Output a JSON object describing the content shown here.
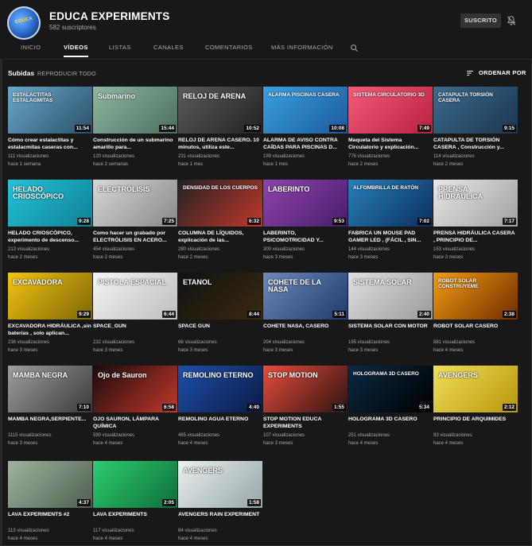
{
  "channel": {
    "name": "EDUCA EXPERIMENTS",
    "subscribers": "582 suscriptores",
    "subscribed_label": "SUSCRITO",
    "avatar_text": "EDUCA"
  },
  "tabs": [
    {
      "label": "INICIO",
      "active": false
    },
    {
      "label": "VÍDEOS",
      "active": true
    },
    {
      "label": "LISTAS",
      "active": false
    },
    {
      "label": "CANALES",
      "active": false
    },
    {
      "label": "COMENTARIOS",
      "active": false
    },
    {
      "label": "MÁS INFORMACIÓN",
      "active": false
    }
  ],
  "section": {
    "title": "Subidas",
    "play_all": "REPRODUCIR TODO",
    "sort_label": "ORDENAR POR"
  },
  "videos": [
    {
      "title": "Cómo crear estalactitas y estalacmitas caseras con...",
      "views": "111 visualizaciones",
      "age": "hace 1 semana",
      "duration": "11:54",
      "thumb_text": "ESTALACTITAS · ESTALAGMITAS",
      "colors": [
        "#6aa9c9",
        "#2b4f6a"
      ]
    },
    {
      "title": "Construcción de un submarino amarillo para...",
      "views": "120 visualizaciones",
      "age": "hace 2 semanas",
      "duration": "15:44",
      "thumb_text": "Submarino",
      "colors": [
        "#8db7a0",
        "#4d6e5e"
      ]
    },
    {
      "title": "RELOJ DE ARENA CASERO. 10 minutos, utiliza este...",
      "views": "231 visualizaciones",
      "age": "hace 1 mes",
      "duration": "10:52",
      "thumb_text": "RELOJ DE ARENA",
      "colors": [
        "#5b5b5b",
        "#222222"
      ]
    },
    {
      "title": "ALARMA DE AVISO CONTRA CAÍDAS PARA PISCINAS D...",
      "views": "199 visualizaciones",
      "age": "hace 1 mes",
      "duration": "10:08",
      "thumb_text": "ALARMA PISCINAS CASERA",
      "colors": [
        "#3aa0e0",
        "#1c5a9a"
      ]
    },
    {
      "title": "Maqueta del Sistema Circulatorio y explicación...",
      "views": "776 visualizaciones",
      "age": "hace 2 meses",
      "duration": "7:49",
      "thumb_text": "SISTEMA CIRCULATORIO 3D",
      "colors": [
        "#f25c7a",
        "#b8203e"
      ]
    },
    {
      "title": "CATAPULTA DE TORSIÓN CASERA , Construcción y...",
      "views": "114 visualizaciones",
      "age": "hace 2 meses",
      "duration": "9:15",
      "thumb_text": "CATAPULTA TORSIÓN CASERA",
      "colors": [
        "#3b6b8e",
        "#1b3650"
      ]
    },
    {
      "title": "HELADO CRIOSCÓPICO, experimento de descenso...",
      "views": "213 visualizaciones",
      "age": "hace 2 meses",
      "duration": "9:28",
      "thumb_text": "HELADO CRIOSCÓPICO",
      "colors": [
        "#26c2d6",
        "#0e8094"
      ]
    },
    {
      "title": "Como hacer un grabado por ELECTRÓLISIS EN ACERO...",
      "views": "454 visualizaciones",
      "age": "hace 2 meses",
      "duration": "7:25",
      "thumb_text": "ELECTRÓLISIS",
      "colors": [
        "#d8d8d8",
        "#888888"
      ]
    },
    {
      "title": "COLUMNA DE LÍQUIDOS, explicación de las...",
      "views": "280 visualizaciones",
      "age": "hace 2 meses",
      "duration": "6:32",
      "thumb_text": "DENSIDAD DE LOS CUERPOS",
      "colors": [
        "#222222",
        "#c0392b"
      ]
    },
    {
      "title": "LABERINTO, PSICOMOTRICIDAD Y...",
      "views": "300 visualizaciones",
      "age": "hace 3 meses",
      "duration": "9:53",
      "thumb_text": "LABERINTO",
      "colors": [
        "#8e44ad",
        "#4a1d68"
      ]
    },
    {
      "title": "FABRICA UN MOUSE PAD GAMER LED , (FÁCIL , SIN...",
      "views": "144 visualizaciones",
      "age": "hace 3 meses",
      "duration": "7:02",
      "thumb_text": "ALFOMBRILLA DE RATÓN",
      "colors": [
        "#2980b9",
        "#0b2e5c"
      ]
    },
    {
      "title": "PRENSA HIDRÁULICA CASERA , PRINCIPIO DE...",
      "views": "153 visualizaciones",
      "age": "hace 3 meses",
      "duration": "7:17",
      "thumb_text": "PRENSA HIDRÁULICA",
      "colors": [
        "#e8e8e8",
        "#a0a0a0"
      ]
    },
    {
      "title": "EXCAVADORA HIDRÁULICA ,sin baterías , solo aplican...",
      "views": "236 visualizaciones",
      "age": "hace 3 meses",
      "duration": "9:29",
      "thumb_text": "EXCAVADORA",
      "colors": [
        "#f1c40f",
        "#7d6608"
      ]
    },
    {
      "title": "SPACE_GUN",
      "views": "232 visualizaciones",
      "age": "hace 3 meses",
      "duration": "6:44",
      "thumb_text": "PISTOLA ESPACIAL",
      "colors": [
        "#f5f5f5",
        "#bdbdbd"
      ]
    },
    {
      "title": "SPACE GUN",
      "views": "66 visualizaciones",
      "age": "hace 3 meses",
      "duration": "8:44",
      "thumb_text": "ETANOL",
      "colors": [
        "#111111",
        "#3a2a10"
      ]
    },
    {
      "title": "COHETE NASA, CASERO",
      "views": "204 visualizaciones",
      "age": "hace 3 meses",
      "duration": "5:11",
      "thumb_text": "COHETE DE LA NASA",
      "colors": [
        "#6c8ab8",
        "#1e3a6e"
      ]
    },
    {
      "title": "SISTEMA SOLAR CON MOTOR",
      "views": "195 visualizaciones",
      "age": "hace 3 meses",
      "duration": "2:40",
      "thumb_text": "SISTEMA SOLAR",
      "colors": [
        "#e0e0e0",
        "#9a9a9a"
      ]
    },
    {
      "title": "ROBOT SOLAR CASERO",
      "views": "881 visualizaciones",
      "age": "hace 4 meses",
      "duration": "2:38",
      "thumb_text": "ROBOT SOLAR CONSTRUYEME",
      "colors": [
        "#f39c12",
        "#6e2c00"
      ]
    },
    {
      "title": "MAMBA NEGRA,SERPIENTE...",
      "views": "1115 visualizaciones",
      "age": "hace 3 meses",
      "duration": "7:10",
      "thumb_text": "MAMBA NEGRA",
      "colors": [
        "#9e9e9e",
        "#3a3a3a"
      ]
    },
    {
      "title": "OJO SAURON, LÁMPARA QUÍMICA",
      "views": "590 visualizaciones",
      "age": "hace 4 meses",
      "duration": "6:58",
      "thumb_text": "Ojo de Sauron",
      "colors": [
        "#1a0a0a",
        "#c0392b"
      ]
    },
    {
      "title": "REMOLINO AGUA ETERNO",
      "views": "465 visualizaciones",
      "age": "hace 4 meses",
      "duration": "4:40",
      "thumb_text": "REMOLINO ETERNO",
      "colors": [
        "#1f4fa8",
        "#0a1a44"
      ]
    },
    {
      "title": "STOP MOTION EDUCA EXPERIMENTS",
      "views": "107 visualizaciones",
      "age": "hace 3 meses",
      "duration": "1:55",
      "thumb_text": "STOP MOTION",
      "colors": [
        "#e74c3c",
        "#2c1410"
      ]
    },
    {
      "title": "HOLOGRAMA 3D CASERO",
      "views": "251 visualizaciones",
      "age": "hace 4 meses",
      "duration": "5:34",
      "thumb_text": "HOLOGRAMA 3D CASERO",
      "colors": [
        "#0a2a44",
        "#000000"
      ]
    },
    {
      "title": "PRINCIPIO DE ARQUIMIDES",
      "views": "93 visualizaciones",
      "age": "hace 4 meses",
      "duration": "2:12",
      "thumb_text": "AVENGERS",
      "colors": [
        "#f1e05a",
        "#b7950b"
      ]
    },
    {
      "title": "LAVA EXPERIMENTS #2",
      "views": "113 visualizaciones",
      "age": "hace 4 meses",
      "duration": "4:37",
      "thumb_text": "",
      "colors": [
        "#9fb3a0",
        "#4e5e4f"
      ]
    },
    {
      "title": "LAVA EXPERIMENTS",
      "views": "117 visualizaciones",
      "age": "hace 4 meses",
      "duration": "2:05",
      "thumb_text": "",
      "colors": [
        "#2ecc71",
        "#0e6e38"
      ]
    },
    {
      "title": "AVENGERS RAIN EXPERIMENT",
      "views": "84 visualizaciones",
      "age": "hace 4 meses",
      "duration": "1:58",
      "thumb_text": "AVENGERS",
      "colors": [
        "#ecf0f1",
        "#95a5a6"
      ]
    }
  ]
}
